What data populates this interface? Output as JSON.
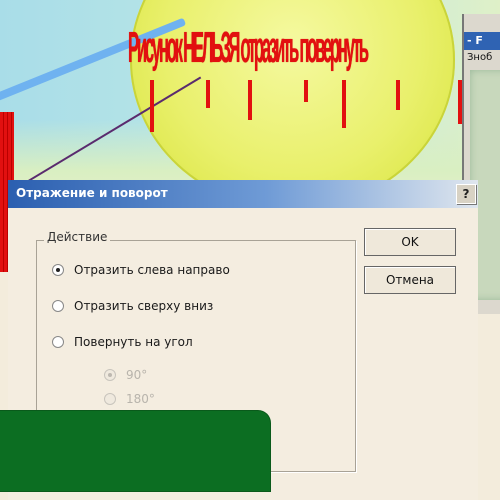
{
  "banner": {
    "text": "Рисунок НЕЛЬЗЯ отразить повернуть"
  },
  "dialog": {
    "title": "Отражение и поворот",
    "help_label": "?",
    "group_label": "Действие",
    "options": [
      {
        "label": "Отразить слева направо",
        "selected": true,
        "enabled": true
      },
      {
        "label": "Отразить сверху вниз",
        "selected": false,
        "enabled": true
      },
      {
        "label": "Повернуть на угол",
        "selected": false,
        "enabled": true
      }
    ],
    "angles": [
      {
        "label": "90°",
        "selected": true
      },
      {
        "label": "180°",
        "selected": false
      }
    ],
    "ok_label": "OK",
    "cancel_label": "Отмена"
  },
  "window2": {
    "title": "- F",
    "menu": "Зноб"
  },
  "colors": {
    "banner_red": "#e21010",
    "title_blue": "#2b5fb0",
    "green_panel": "#0c6e22",
    "ball_yellow": "#e9f06c"
  }
}
